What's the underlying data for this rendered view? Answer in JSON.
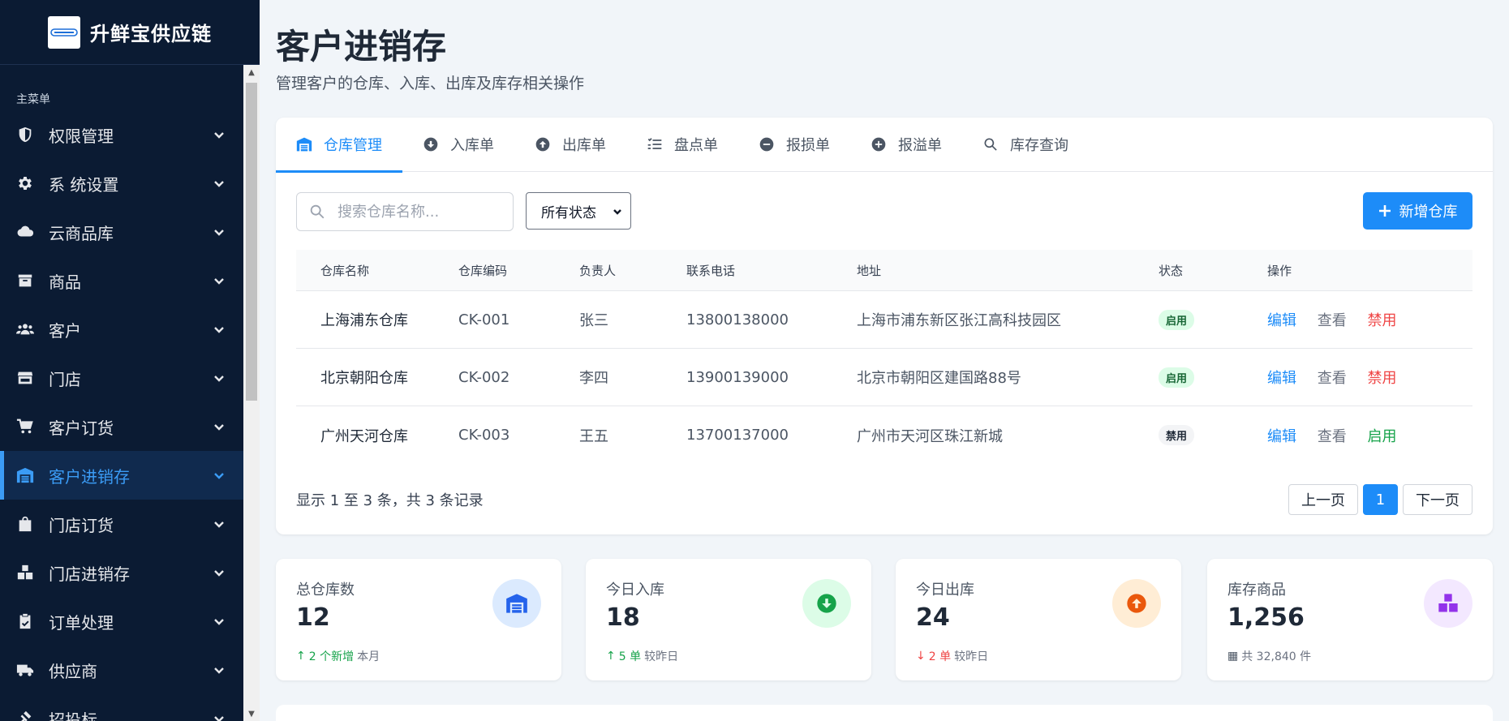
{
  "brand": {
    "title": "升鲜宝供应链"
  },
  "sidebar": {
    "section_label": "主菜单",
    "items": [
      {
        "label": "权限管理",
        "icon": "shield-icon"
      },
      {
        "label": "系 统设置",
        "icon": "gear-icon"
      },
      {
        "label": "云商品库",
        "icon": "cloud-icon"
      },
      {
        "label": "商品",
        "icon": "box-icon"
      },
      {
        "label": "客户",
        "icon": "users-icon"
      },
      {
        "label": "门店",
        "icon": "store-icon"
      },
      {
        "label": "客户订货",
        "icon": "cart-icon"
      },
      {
        "label": "客户进销存",
        "icon": "warehouse-icon",
        "active": true
      },
      {
        "label": "门店订货",
        "icon": "shopping-bag-icon"
      },
      {
        "label": "门店进销存",
        "icon": "boxes-icon"
      },
      {
        "label": "订单处理",
        "icon": "clipboard-check-icon"
      },
      {
        "label": "供应商",
        "icon": "truck-icon"
      },
      {
        "label": "招投标",
        "icon": "gavel-icon"
      }
    ]
  },
  "header": {
    "title": "客户进销存",
    "subtitle": "管理客户的仓库、入库、出库及库存相关操作"
  },
  "tabs": [
    {
      "label": "仓库管理",
      "icon": "warehouse-icon",
      "active": true
    },
    {
      "label": "入库单",
      "icon": "arrow-down-circle-icon"
    },
    {
      "label": "出库单",
      "icon": "arrow-up-circle-icon"
    },
    {
      "label": "盘点单",
      "icon": "list-check-icon"
    },
    {
      "label": "报损单",
      "icon": "minus-circle-icon"
    },
    {
      "label": "报溢单",
      "icon": "plus-circle-icon"
    },
    {
      "label": "库存查询",
      "icon": "search-icon"
    }
  ],
  "toolbar": {
    "search_placeholder": "搜索仓库名称...",
    "status_select": "所有状态",
    "add_label": "新增仓库"
  },
  "table": {
    "headers": [
      "仓库名称",
      "仓库编码",
      "负责人",
      "联系电话",
      "地址",
      "状态",
      "操作"
    ],
    "rows": [
      {
        "name": "上海浦东仓库",
        "code": "CK-001",
        "manager": "张三",
        "phone": "13800138000",
        "address": "上海市浦东新区张江高科技园区",
        "status": "启用",
        "actions": [
          "编辑",
          "查看",
          "禁用"
        ]
      },
      {
        "name": "北京朝阳仓库",
        "code": "CK-002",
        "manager": "李四",
        "phone": "13900139000",
        "address": "北京市朝阳区建国路88号",
        "status": "启用",
        "actions": [
          "编辑",
          "查看",
          "禁用"
        ]
      },
      {
        "name": "广州天河仓库",
        "code": "CK-003",
        "manager": "王五",
        "phone": "13700137000",
        "address": "广州市天河区珠江新城",
        "status": "禁用",
        "actions": [
          "编辑",
          "查看",
          "启用"
        ]
      }
    ]
  },
  "pagination": {
    "info": "显示 1 至 3 条，共 3 条记录",
    "prev": "上一页",
    "current": "1",
    "next": "下一页"
  },
  "stats": [
    {
      "label": "总仓库数",
      "value": "12",
      "trend_value": "2 个新增",
      "trend_text": "本月",
      "direction": "up",
      "icon": "warehouse-icon",
      "color": "#2563eb",
      "bg": "#dbeafe"
    },
    {
      "label": "今日入库",
      "value": "18",
      "trend_value": "5 单",
      "trend_text": "较昨日",
      "direction": "up",
      "icon": "arrow-down-circle-icon",
      "color": "#16a34a",
      "bg": "#dcfce7"
    },
    {
      "label": "今日出库",
      "value": "24",
      "trend_value": "2 单",
      "trend_text": "较昨日",
      "direction": "down",
      "icon": "arrow-up-circle-icon",
      "color": "#ea580c",
      "bg": "#ffedd5"
    },
    {
      "label": "库存商品",
      "value": "1,256",
      "trend_value": "",
      "trend_text": "共 32,840 件",
      "direction": "none",
      "icon": "boxes-icon",
      "color": "#9333ea",
      "bg": "#f3e8ff"
    }
  ],
  "colors": {
    "primary": "#1d8cf8",
    "sidebar_bg": "#0b1b33",
    "danger": "#ef4444",
    "success": "#16a34a"
  }
}
